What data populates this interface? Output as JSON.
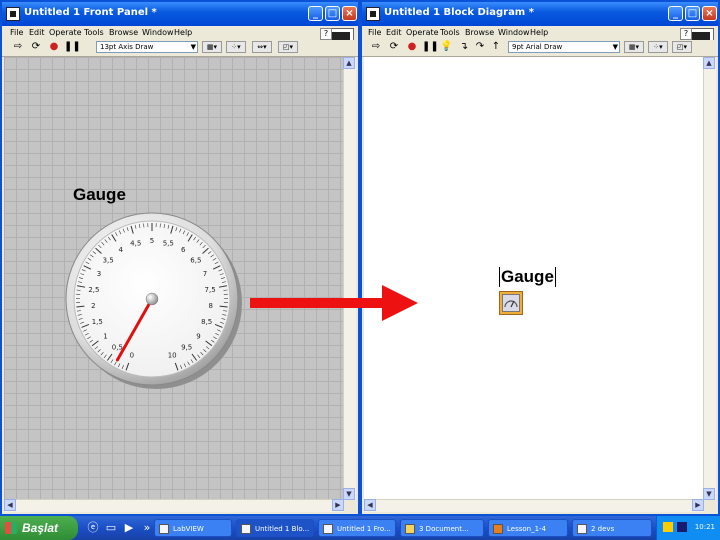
{
  "front_panel": {
    "title": "Untitled 1 Front Panel *",
    "menus": [
      "File",
      "Edit",
      "Operate",
      "Tools",
      "Browse",
      "Window",
      "Help"
    ],
    "font": "13pt Axis Draw",
    "gauge": {
      "label": "Gauge",
      "scale_min": 0,
      "scale_max": 10,
      "value": 0.3,
      "ticks": [
        "0",
        "0,5",
        "1",
        "1,5",
        "2",
        "2,5",
        "3",
        "3,5",
        "4",
        "4,5",
        "5",
        "5,5",
        "6",
        "6,5",
        "7",
        "7,5",
        "8",
        "8,5",
        "9",
        "9,5",
        "10"
      ]
    }
  },
  "block_diagram": {
    "title": "Untitled 1 Block Diagram *",
    "menus": [
      "File",
      "Edit",
      "Operate",
      "Tools",
      "Browse",
      "Window",
      "Help"
    ],
    "font": "9pt Arial Draw",
    "terminal_label": "Gauge"
  },
  "colors": {
    "needle": "#e01010",
    "arrow": "#ee1111",
    "titlebar": "#0a5be0"
  },
  "taskbar": {
    "start_label": "Başlat",
    "tasks": [
      "LabVIEW",
      "Untitled 1 Blo...",
      "Untitled 1 Fro...",
      "3 Document...",
      "Lesson_1-4",
      "2 devs"
    ],
    "clock": "10:21"
  }
}
